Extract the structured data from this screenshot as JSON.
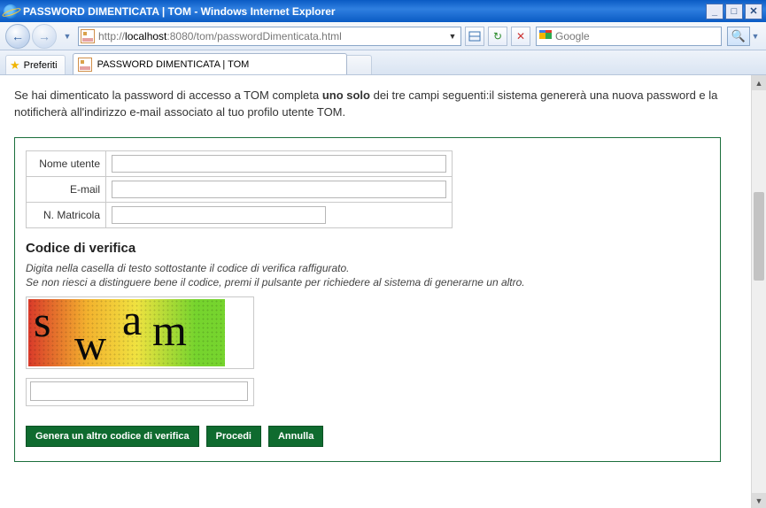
{
  "window": {
    "title": "PASSWORD DIMENTICATA | TOM - Windows Internet Explorer"
  },
  "nav": {
    "url_pre": "http://",
    "url_host": "localhost",
    "url_rest": ":8080/tom/passwordDimenticata.html",
    "search_placeholder": "Google"
  },
  "favorites_label": "Preferiti",
  "tab": {
    "title": "PASSWORD DIMENTICATA | TOM"
  },
  "intro": {
    "pre": "Se hai dimenticato la password di accesso a TOM completa ",
    "bold": "uno solo",
    "post": " dei tre campi seguenti:il sistema genererà una nuova password e la notificherà all'indirizzo e-mail associato al tuo profilo utente TOM."
  },
  "fields": {
    "username_label": "Nome utente",
    "username_value": "",
    "email_label": "E-mail",
    "email_value": "",
    "matricola_label": "N. Matricola",
    "matricola_value": ""
  },
  "verify": {
    "title": "Codice di verifica",
    "help_line1": "Digita nella casella di testo sottostante il codice di verifica raffigurato.",
    "help_line2": "Se non riesci a distinguere bene il codice, premi il pulsante per richiedere al sistema di generarne un altro.",
    "captcha_text": "swam",
    "input_value": ""
  },
  "buttons": {
    "regen": "Genera un altro codice di verifica",
    "proceed": "Procedi",
    "cancel": "Annulla"
  }
}
